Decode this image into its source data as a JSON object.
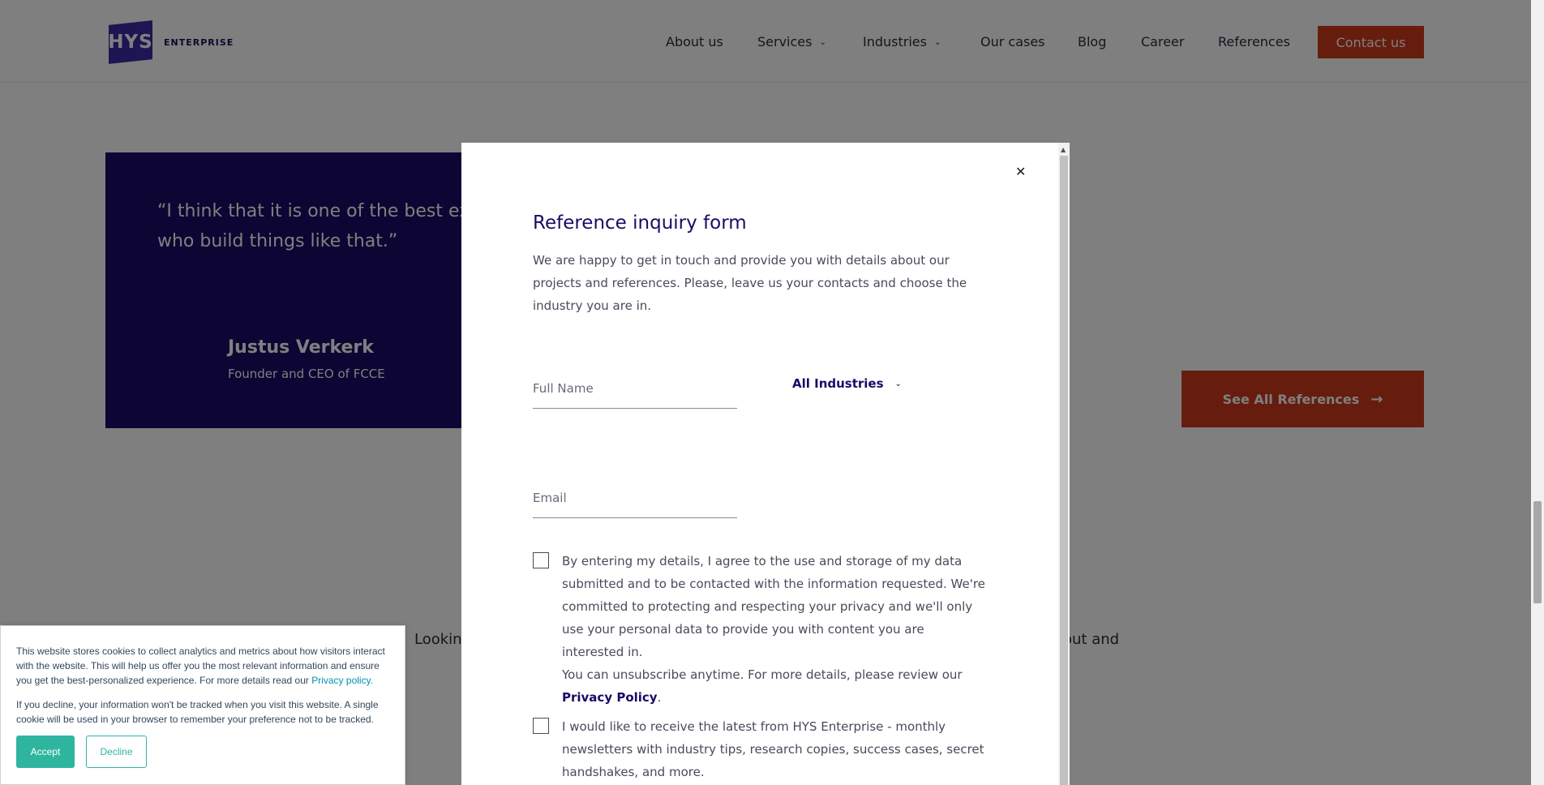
{
  "header": {
    "logo_text": "HYS",
    "logo_subtext": "ENTERPRISE",
    "nav": [
      {
        "label": "About us"
      },
      {
        "label": "Services"
      },
      {
        "label": "Industries"
      },
      {
        "label": "Our cases"
      },
      {
        "label": "Blog"
      },
      {
        "label": "Career"
      },
      {
        "label": "References"
      }
    ],
    "contact_label": "Contact us"
  },
  "testimonial": {
    "quote": "“I think that it is one of the best experiences to work with people who build things like that.”",
    "name": "Justus Verkerk",
    "role": "Founder and CEO of FCCE"
  },
  "see_all_label": "See All References",
  "looking_fragment_left": "Looking",
  "looking_fragment_right": "out and",
  "modal": {
    "title": "Reference inquiry form",
    "description": "We are happy to get in touch and provide you with details about our projects and references. Please, leave us your contacts and choose the industry you are in.",
    "fullname_placeholder": "Full Name",
    "email_placeholder": "Email",
    "industry_selected": "All Industries",
    "consent_text": "By entering my details, I agree to the use and storage of my data submitted and to be contacted with the information requested. We're committed to protecting and respecting your privacy and we'll only use your personal data to provide you with content you are interested in.",
    "unsubscribe_text": "You can unsubscribe anytime. For more details, please review our",
    "privacy_link": "Privacy Policy",
    "newsletter_text": "I would like to receive the latest from HYS Enterprise - monthly newsletters with industry tips, research copies, success cases, secret handshakes, and more."
  },
  "cookie": {
    "text1": "This website stores cookies to collect analytics and metrics about how visitors interact with the website. This will help us offer you the most relevant information and ensure you get the best-personalized experience. For more details read our",
    "privacy_link": "Privacy policy.",
    "text2": "If you decline, your information won't be tracked when you visit this website. A single cookie will be used in your browser to remember your preference not to be tracked.",
    "accept_label": "Accept",
    "decline_label": "Decline"
  },
  "colors": {
    "brand_navy": "#1a0b66",
    "brand_purple": "#3a2aa8",
    "accent_orange": "#cc3b1d",
    "cookie_teal": "#2fb59f"
  }
}
